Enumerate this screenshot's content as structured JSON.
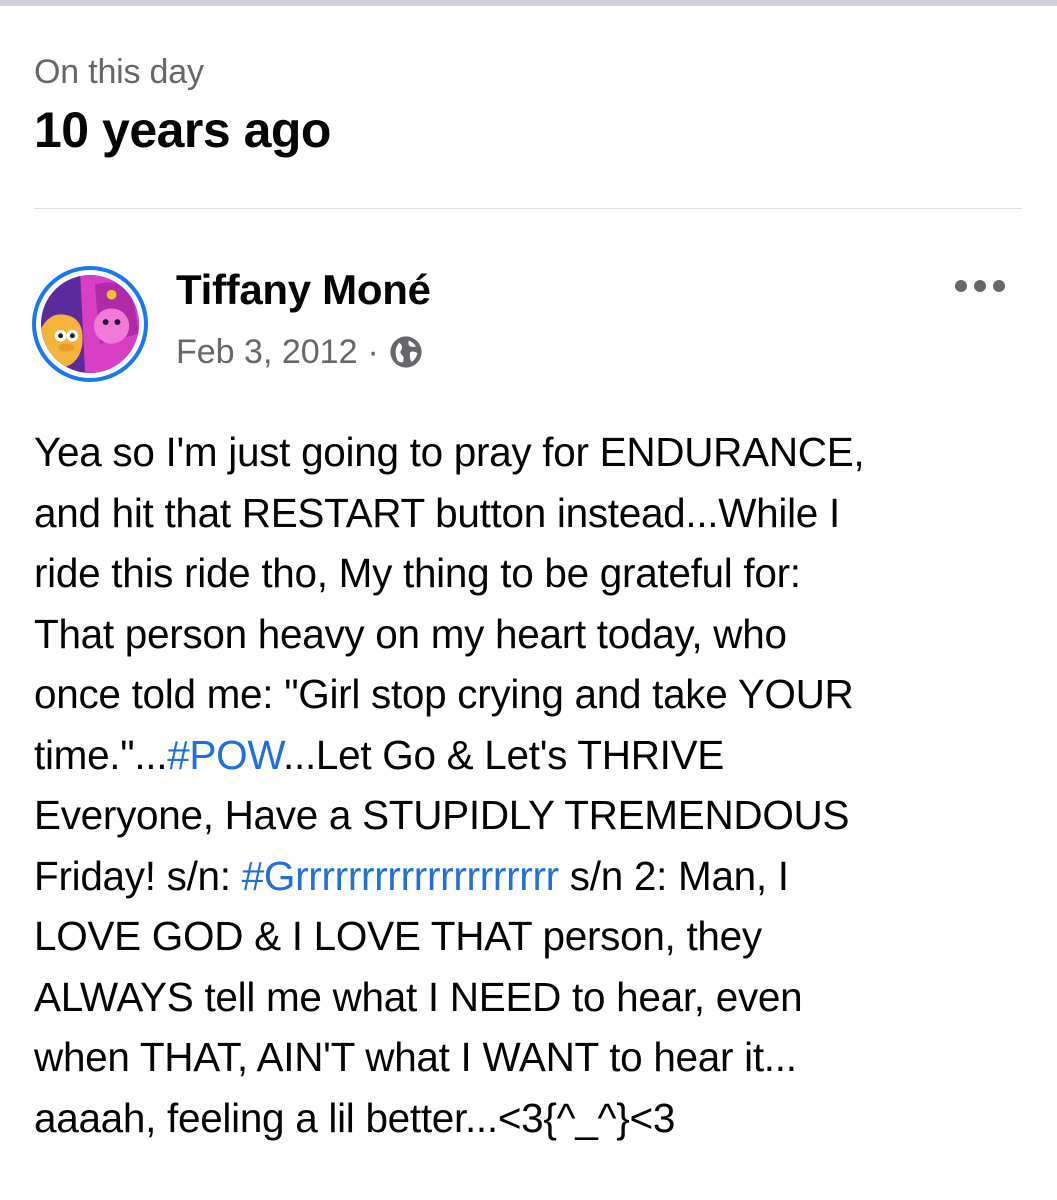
{
  "header": {
    "subtitle": "On this day",
    "title": "10 years ago"
  },
  "post": {
    "author": "Tiffany Moné",
    "date": "Feb 3, 2012",
    "separator": "·",
    "privacy_icon": "globe-icon",
    "more_icon": "more-options-icon",
    "text_lines": {
      "l1": "Yea so I'm just going to pray for ENDURANCE,",
      "l2": "and hit that RESTART button instead...While I",
      "l3": "ride this ride tho, My thing to be grateful for:",
      "l4": "That person heavy on my heart today, who",
      "l5": "once told me: \"Girl stop crying and take YOUR",
      "l6_pre": "time.\"...",
      "l6_tag": "#POW",
      "l6_post": "...Let Go & Let's THRIVE",
      "l7": "Everyone, Have a STUPIDLY TREMENDOUS",
      "l8_pre": "Friday! s/n: ",
      "l8_tag": "#Grrrrrrrrrrrrrrrrrrrr",
      "l8_post": " s/n 2: Man, I",
      "l9": "LOVE GOD & I LOVE THAT person, they",
      "l10": "ALWAYS tell me what I NEED to hear, even",
      "l11": "when THAT, AIN'T what I WANT to hear it...",
      "l12": "aaaah, feeling a lil better...<3{^_^}<3"
    }
  },
  "colors": {
    "link": "#216fdb",
    "secondary_text": "#65676b",
    "avatar_ring": "#1877f2"
  }
}
